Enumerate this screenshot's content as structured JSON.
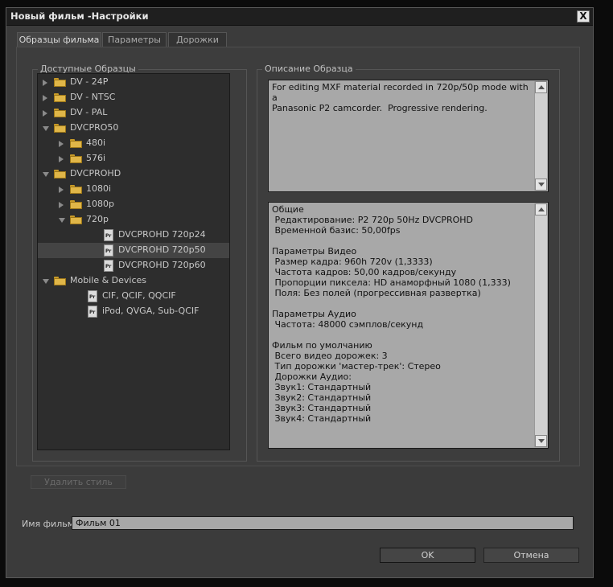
{
  "window": {
    "title": "Новый фильм -Настройки",
    "close_label": "X"
  },
  "tabs": [
    {
      "label": "Образцы фильма",
      "active": true
    },
    {
      "label": "Параметры",
      "active": false
    },
    {
      "label": "Дорожки",
      "active": false
    }
  ],
  "presets": {
    "label": "Доступные Образцы",
    "items": [
      {
        "label": "DV - 24P",
        "type": "folder",
        "level": 0,
        "expanded": false
      },
      {
        "label": "DV - NTSC",
        "type": "folder",
        "level": 0,
        "expanded": false
      },
      {
        "label": "DV - PAL",
        "type": "folder",
        "level": 0,
        "expanded": false
      },
      {
        "label": "DVCPRO50",
        "type": "folder",
        "level": 0,
        "expanded": true
      },
      {
        "label": "480i",
        "type": "folder",
        "level": 1,
        "expanded": false
      },
      {
        "label": "576i",
        "type": "folder",
        "level": 1,
        "expanded": false
      },
      {
        "label": "DVCPROHD",
        "type": "folder",
        "level": 0,
        "expanded": true
      },
      {
        "label": "1080i",
        "type": "folder",
        "level": 1,
        "expanded": false
      },
      {
        "label": "1080p",
        "type": "folder",
        "level": 1,
        "expanded": false
      },
      {
        "label": "720p",
        "type": "folder",
        "level": 1,
        "expanded": true
      },
      {
        "label": "DVCPROHD 720p24",
        "type": "file",
        "level": 2
      },
      {
        "label": "DVCPROHD 720p50",
        "type": "file",
        "level": 2,
        "selected": true
      },
      {
        "label": "DVCPROHD 720p60",
        "type": "file",
        "level": 2
      },
      {
        "label": "Mobile & Devices",
        "type": "folder",
        "level": 0,
        "expanded": true
      },
      {
        "label": "CIF, QCIF, QQCIF",
        "type": "file",
        "level": 1
      },
      {
        "label": "iPod, QVGA, Sub-QCIF",
        "type": "file",
        "level": 1
      }
    ]
  },
  "description": {
    "label": "Описание Образца",
    "text": "For editing MXF material recorded in 720p/50p mode with a\nPanasonic P2 camcorder.  Progressive rendering."
  },
  "details": {
    "text": "Общие\n Редактирование: P2 720p 50Hz DVCPROHD\n Временной базис: 50,00fps\n\nПараметры Видео\n Размер кадра: 960h 720v (1,3333)\n Частота кадров: 50,00 кадров/секунду\n Пропорции пиксела: HD анаморфный 1080 (1,333)\n Поля: Без полей (прогрессивная развертка)\n\nПараметры Аудио\n Частота: 48000 сэмплов/секунд\n\nФильм по умолчанию\n Всего видео дорожек: 3\n Тип дорожки 'мастер-трек': Стерео\n Дорожки Аудио:\n Звук1: Стандартный\n Звук2: Стандартный\n Звук3: Стандартный\n Звук4: Стандартный"
  },
  "delete_style_label": "Удалить стиль",
  "film_name": {
    "label": "Имя фильма:",
    "value": "Фильм 01"
  },
  "buttons": {
    "ok": "OK",
    "cancel": "Отмена"
  },
  "colors": {
    "window_bg": "#3b3b3b",
    "field_bg": "#a8a8a8",
    "folder": "#e0b648"
  }
}
